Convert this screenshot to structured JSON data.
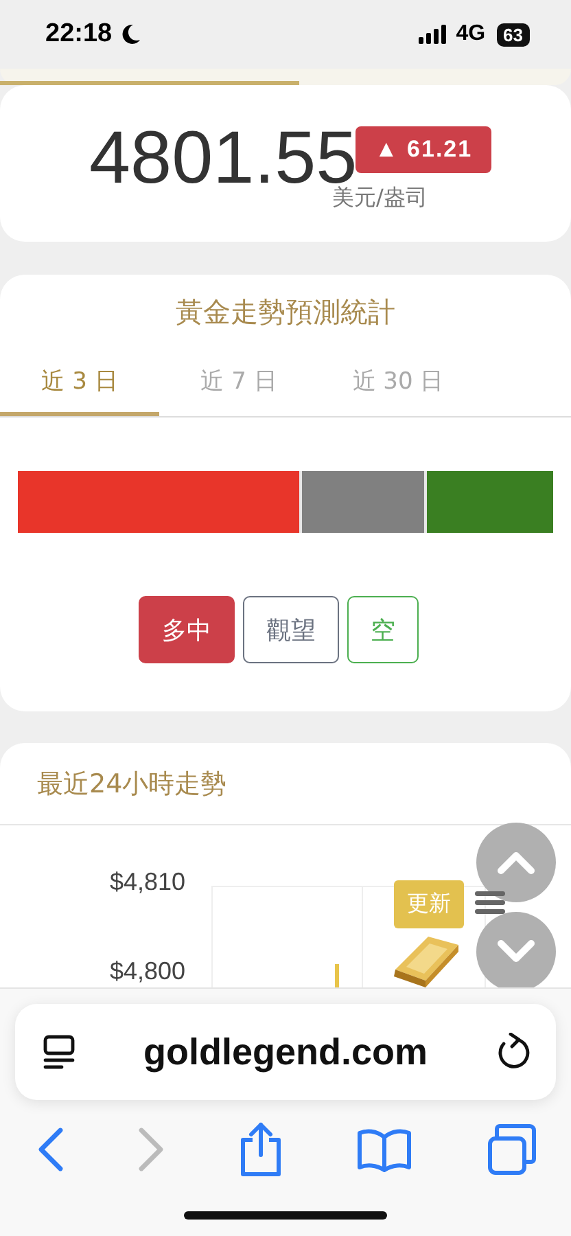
{
  "status_bar": {
    "time": "22:18",
    "network": "4G",
    "battery": "63"
  },
  "price": {
    "value": "4801.55",
    "change": "▲ 61.21",
    "unit": "美元/盎司"
  },
  "forecast": {
    "title": "黃金走勢預測統計",
    "tabs": [
      {
        "label": "近 3 日",
        "selected": true
      },
      {
        "label": "近 7 日",
        "selected": false
      },
      {
        "label": "近 30 日",
        "selected": false
      }
    ],
    "segments": [
      {
        "level": 0.526,
        "color": "#e8352a"
      },
      {
        "color": "#808080"
      },
      {
        "level": 0.237,
        "color": "#3a7f22"
      }
    ],
    "buttons": [
      {
        "label": "多中",
        "color": "#cc4049",
        "selected": true
      },
      {
        "label": "觀望",
        "color": "#6b7280",
        "selected": false
      },
      {
        "label": "空",
        "color": "#4caf50",
        "selected": false
      }
    ]
  },
  "trend": {
    "title": "最近24小時走勢",
    "y_labels": [
      "$4,810",
      "$4,800"
    ]
  },
  "floating": {
    "update_label": "更新"
  },
  "browser": {
    "url": "goldlegend.com",
    "forward_disabled": true
  }
}
